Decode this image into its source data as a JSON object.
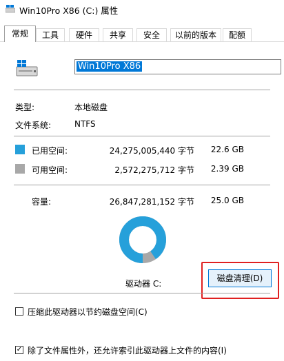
{
  "window": {
    "title": "Win10Pro X86 (C:) 属性"
  },
  "tabs": [
    {
      "label": "常规"
    },
    {
      "label": "工具"
    },
    {
      "label": "硬件"
    },
    {
      "label": "共享"
    },
    {
      "label": "安全"
    },
    {
      "label": "以前的版本"
    },
    {
      "label": "配额"
    }
  ],
  "general": {
    "drive_name_value": "Win10Pro X86",
    "type_label": "类型:",
    "type_value": "本地磁盘",
    "fs_label": "文件系统:",
    "fs_value": "NTFS",
    "used": {
      "label": "已用空间:",
      "bytes": "24,275,005,440 字节",
      "size": "22.6 GB",
      "color": "#26a0da"
    },
    "free": {
      "label": "可用空间:",
      "bytes": "2,572,275,712 字节",
      "size": "2.39 GB",
      "color": "#a8a8a8"
    },
    "capacity": {
      "label": "容量:",
      "bytes": "26,847,281,152 字节",
      "size": "25.0 GB"
    },
    "used_fraction": 0.904,
    "drive_label": "驱动器 C:",
    "cleanup_button": "磁盘清理(D)",
    "compress_label": "压缩此驱动器以节约磁盘空间(C)",
    "compress_checked": false,
    "index_label": "除了文件属性外，还允许索引此驱动器上文件的内容(I)",
    "index_checked": true
  }
}
